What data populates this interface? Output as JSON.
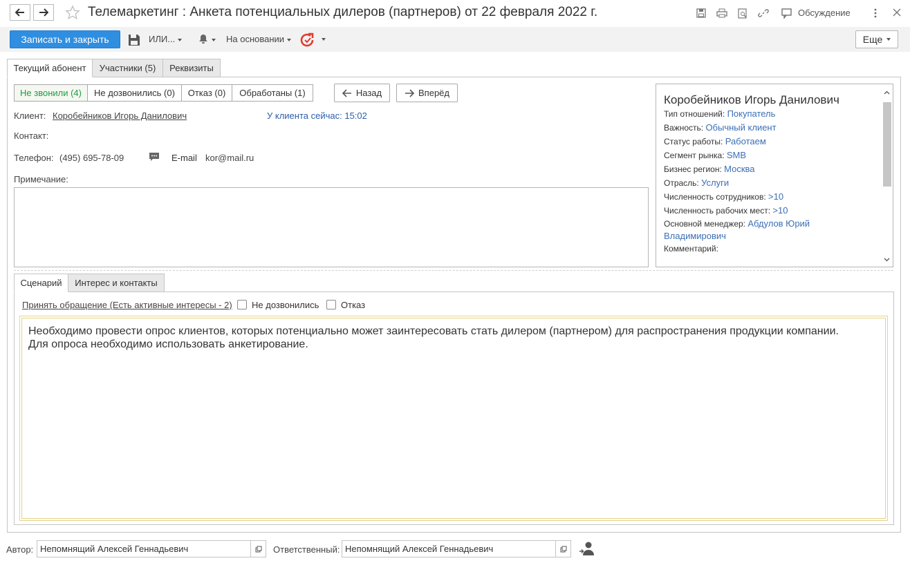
{
  "window": {
    "title": "Телемаркетинг : Анкета потенциальных дилеров (партнеров) от 22 февраля 2022 г.",
    "discussion_label": "Обсуждение"
  },
  "toolbar": {
    "save_close_label": "Записать и закрыть",
    "ili_label": "ИЛИ...",
    "based_on_label": "На основании",
    "more_label": "Еще"
  },
  "tabs": [
    {
      "label": "Текущий абонент"
    },
    {
      "label": "Участники (5)"
    },
    {
      "label": "Реквизиты"
    }
  ],
  "filters": [
    {
      "label": "Не звонили (4)"
    },
    {
      "label": "Не дозвонились (0)"
    },
    {
      "label": "Отказ (0)"
    },
    {
      "label": "Обработаны (1)"
    }
  ],
  "nav": {
    "back_label": "Назад",
    "forward_label": "Вперёд"
  },
  "subscriber": {
    "client_label": "Клиент:",
    "client_value": "Коробейников Игорь Данилович",
    "client_time_label": "У клиента сейчас:",
    "client_time_value": "15:02",
    "contact_label": "Контакт:",
    "phone_label": "Телефон:",
    "phone_value": "(495) 695-78-09",
    "email_label": "E-mail",
    "email_value": "kor@mail.ru",
    "note_label": "Примечание:"
  },
  "card": {
    "name": "Коробейников Игорь Данилович",
    "rows": [
      {
        "label": "Тип отношений:",
        "value": "Покупатель"
      },
      {
        "label": "Важность:",
        "value": "Обычный клиент"
      },
      {
        "label": "Статус работы:",
        "value": "Работаем"
      },
      {
        "label": "Сегмент рынка:",
        "value": "SMB"
      },
      {
        "label": "Бизнес регион:",
        "value": "Москва"
      },
      {
        "label": "Отрасль:",
        "value": "Услуги"
      },
      {
        "label": "Численность сотрудников:",
        "value": ">10"
      },
      {
        "label": "Численность рабочих мест:",
        "value": ">10"
      },
      {
        "label": "Основной менеджер:",
        "value": "Абдулов Юрий"
      }
    ],
    "manager_cont": "Владимирович",
    "comment_label": "Комментарий:"
  },
  "subtabs": [
    {
      "label": "Сценарий"
    },
    {
      "label": "Интерес и контакты"
    }
  ],
  "scenario": {
    "accept_link": "Принять обращение (Есть активные интересы - 2)",
    "not_reached_label": "Не дозвонились",
    "refuse_label": "Отказ",
    "text_line1": "Необходимо провести опрос клиентов, которых потенциально может заинтересовать стать дилером (партнером) для распространения продукции компании.",
    "text_line2": "Для опроса необходимо использовать анкетирование."
  },
  "footer": {
    "author_label": "Автор:",
    "author_value": "Непомнящий Алексей Геннадьевич",
    "responsible_label": "Ответственный:",
    "responsible_value": "Непомнящий Алексей Геннадьевич"
  },
  "colors": {
    "primary": "#2f8ee0",
    "link": "#1a7cc4",
    "active_filter": "#1f9a4a",
    "card_value": "#3b6fb5"
  }
}
